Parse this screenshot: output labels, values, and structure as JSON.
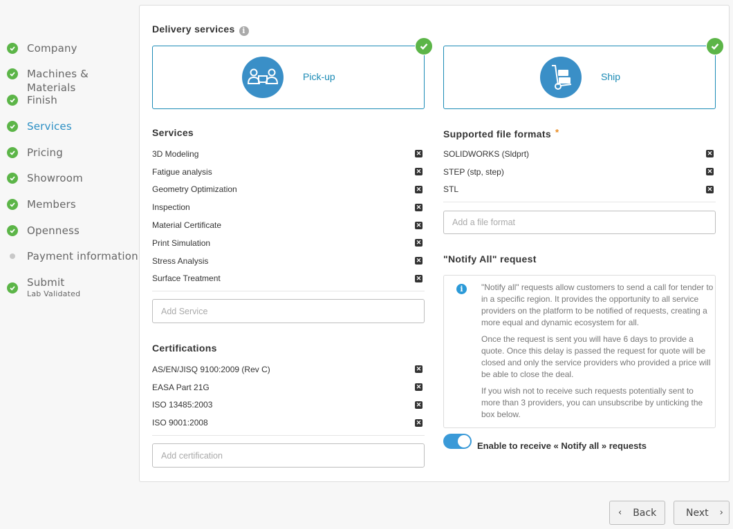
{
  "sidebar": {
    "steps": [
      {
        "label": "Company",
        "status": "done"
      },
      {
        "label": "Machines & Materials",
        "status": "done"
      },
      {
        "label": "Finish",
        "status": "done"
      },
      {
        "label": "Services",
        "status": "done",
        "active": true
      },
      {
        "label": "Pricing",
        "status": "done"
      },
      {
        "label": "Showroom",
        "status": "done"
      },
      {
        "label": "Members",
        "status": "done"
      },
      {
        "label": "Openness",
        "status": "done"
      },
      {
        "label": "Payment information",
        "status": "pending"
      },
      {
        "label": "Submit",
        "status": "done",
        "sublabel": "Lab Validated"
      }
    ]
  },
  "delivery": {
    "title": "Delivery services",
    "options": [
      {
        "label": "Pick-up",
        "icon": "pickup-icon",
        "selected": true
      },
      {
        "label": "Ship",
        "icon": "hand-truck-icon",
        "selected": true
      }
    ]
  },
  "services": {
    "title": "Services",
    "items": [
      "3D Modeling",
      "Fatigue analysis",
      "Geometry Optimization",
      "Inspection",
      "Material Certificate",
      "Print Simulation",
      "Stress Analysis",
      "Surface Treatment"
    ],
    "placeholder": "Add Service"
  },
  "certifications": {
    "title": "Certifications",
    "items": [
      "AS/EN/JISQ 9100:2009 (Rev C)",
      "EASA Part 21G",
      "ISO 13485:2003",
      "ISO 9001:2008"
    ],
    "placeholder": "Add certification"
  },
  "file_formats": {
    "title": "Supported file formats",
    "required_mark": "*",
    "items": [
      "SOLIDWORKS (Sldprt)",
      "STEP (stp, step)",
      "STL"
    ],
    "placeholder": "Add a file format"
  },
  "notify": {
    "title": "\"Notify All\" request",
    "paragraphs": [
      "\"Notify all\" requests allow customers to send a call for tender to in a specific region. It provides the opportunity to all service providers on the platform to be notified of requests, creating a more equal and dynamic ecosystem for all.",
      "Once the request is sent you will have 6 days to provide a quote. Once this delay is passed the request for quote will be closed and only the service providers who provided a price will be able to close the deal.",
      "If you wish not to receive such requests potentially sent to more than 3 providers, you can unsubscribe by unticking the box below."
    ],
    "toggle_label": "Enable to receive « Notify all » requests",
    "toggle_on": true
  },
  "nav": {
    "back_label": "Back",
    "next_label": "Next"
  },
  "colors": {
    "accent": "#1a8ab5",
    "success": "#5cb548",
    "required": "#e8891d"
  }
}
